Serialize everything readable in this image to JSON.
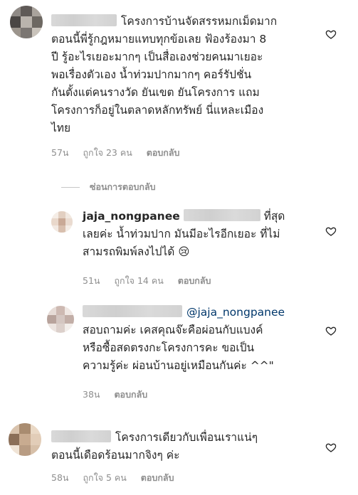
{
  "comments": [
    {
      "lines": [
        "โครงการบ้านจัดสรรหมกเม็ดมาก",
        "ตอนนี้พี่รู้กฎหมายแทบทุกข้อเลย ฟ้องร้องมา 8",
        "ปี รู้อะไรเยอะมากๆ เป็นสื่อเองช่วยคนมาเยอะ",
        "พอเรื่องตัวเอง น้ำท่วมปากมากๆ คอร์รัปชั่น",
        "กันตั้งแต่คนรางวัด ยันเขต ยันโครงการ แถม",
        "โครงการก็อยู่ในตลาดหลักทรัพย์ นี่แหละเมือง",
        "ไทย"
      ],
      "time": "57น",
      "likes": "ถูกใจ 23 คน",
      "reply": "ตอบกลับ"
    }
  ],
  "hide_replies": "ซ่อนการตอบกลับ",
  "reply1": {
    "username": "jaja_nongpanee",
    "first_line_tail": "ที่สุด",
    "lines": [
      "เลยค่ะ น้ำท่วมปาก มันมีอะไรอีกเยอะ ที่ไม่",
      "สามรถพิมพ์ลงไปได้ 😢"
    ],
    "time": "51น",
    "likes": "ถูกใจ 14 คน",
    "reply": "ตอบกลับ"
  },
  "reply2": {
    "mention": "@jaja_nongpanee",
    "lines": [
      "สอบถามค่ะ เคสคุณจ๊ะคือผ่อนกับแบงค์",
      "หรือซื้อสดตรงกะโครงการคะ ขอเป็น",
      "ความรู้ค่ะ ผ่อนบ้านอยู่เหมือนกันค่ะ ^^\""
    ],
    "time": "38น",
    "reply": "ตอบกลับ"
  },
  "comment2": {
    "first_line_tail": "โครงการเดียวกับเพื่อนเราแน่ๆ",
    "lines": [
      "ตอนนี้เดือดร้อนมากจิงๆ ค่ะ"
    ],
    "time": "58น",
    "likes": "ถูกใจ 5 คน",
    "reply": "ตอบกลับ"
  },
  "icons": {
    "like": "heart-icon"
  },
  "colors": {
    "text": "#262626",
    "meta": "#8e8e8e",
    "mention": "#00376b"
  }
}
